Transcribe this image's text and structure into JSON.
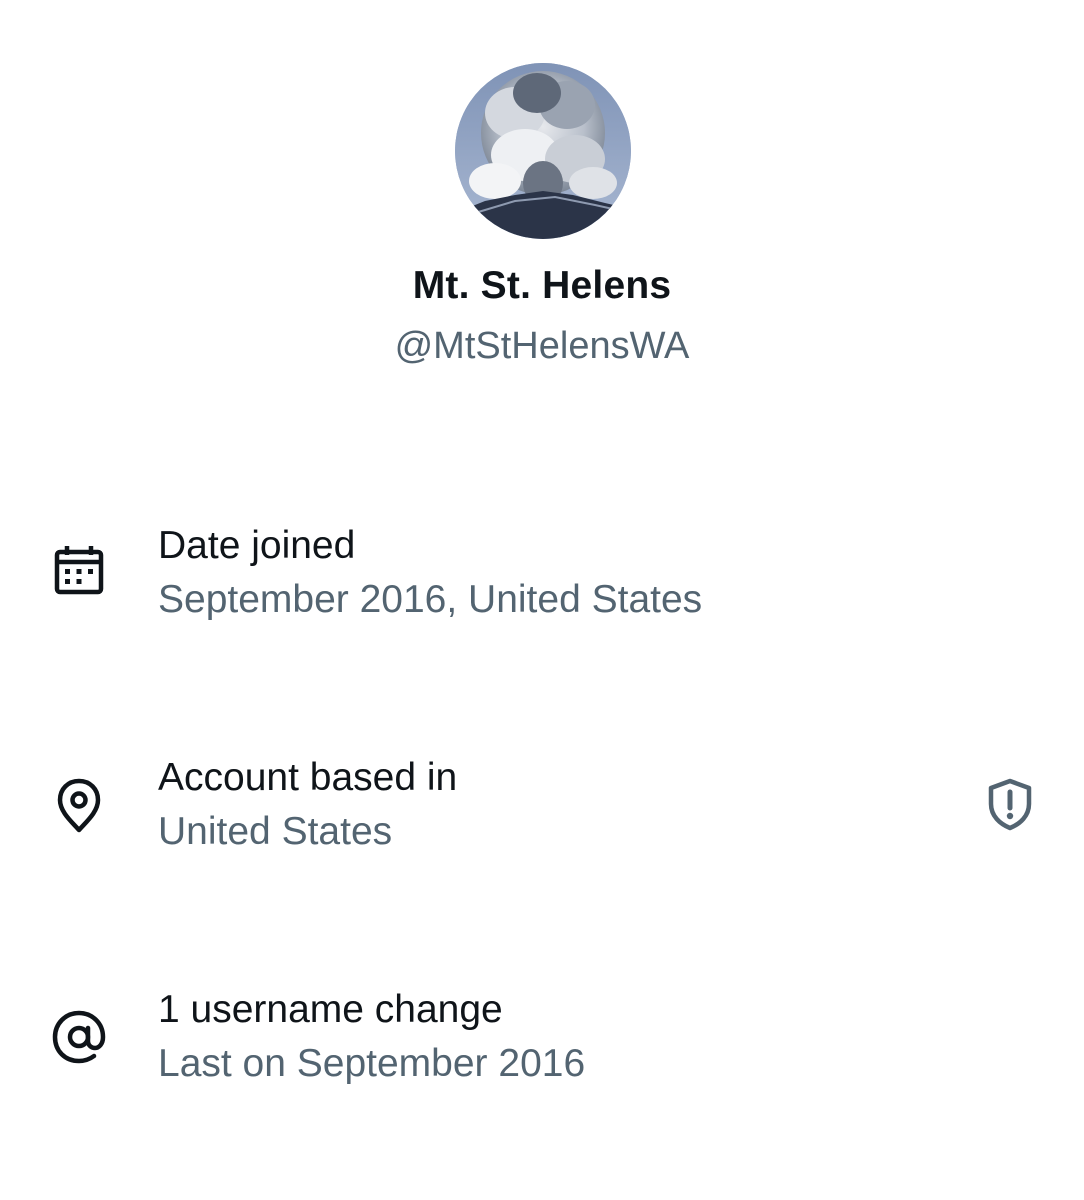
{
  "profile": {
    "display_name": "Mt. St. Helens",
    "handle": "@MtStHelensWA",
    "avatar_icon": "volcano-eruption-photo"
  },
  "about": {
    "date_joined": {
      "icon": "calendar-icon",
      "title": "Date joined",
      "value": "September 2016, United States"
    },
    "account_based_in": {
      "icon": "location-pin-icon",
      "title": "Account based in",
      "value": "United States",
      "action_icon": "shield-alert-icon"
    },
    "username_changes": {
      "icon": "at-sign-icon",
      "title": "1 username change",
      "value": "Last on September 2016"
    }
  },
  "colors": {
    "primary_text": "#0f1419",
    "secondary_text": "#536471",
    "background": "#ffffff"
  }
}
